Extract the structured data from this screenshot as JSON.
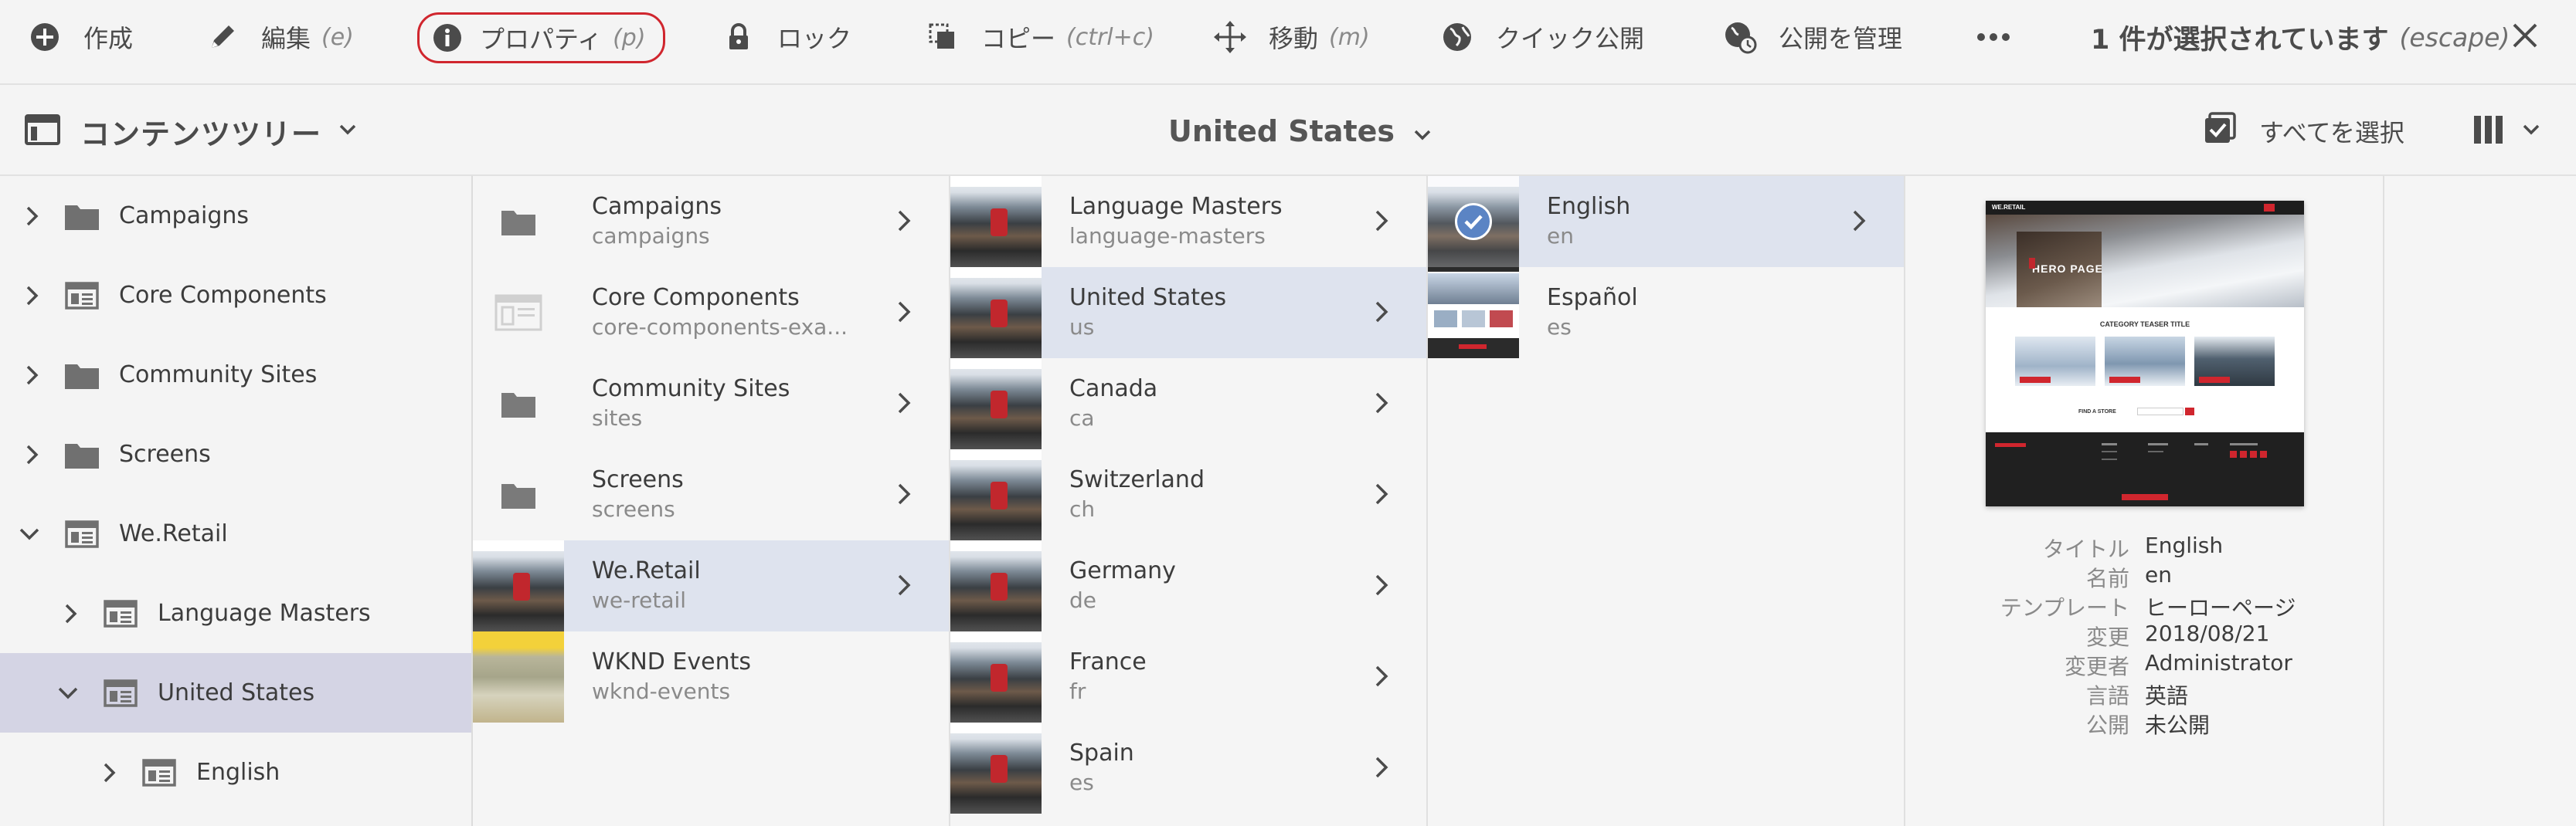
{
  "actionbar": {
    "create": {
      "label": "作成",
      "icon": "plus-circle-icon"
    },
    "edit": {
      "label": "編集",
      "shortcut": "(e)",
      "icon": "pencil-icon"
    },
    "properties": {
      "label": "プロパティ",
      "shortcut": "(p)",
      "icon": "info-icon"
    },
    "lock": {
      "label": "ロック",
      "icon": "lock-icon"
    },
    "copy": {
      "label": "コピー",
      "shortcut": "(ctrl+c)",
      "icon": "copy-icon"
    },
    "move": {
      "label": "移動",
      "shortcut": "(m)",
      "icon": "move-icon"
    },
    "quick_publish": {
      "label": "クイック公開",
      "icon": "globe-icon"
    },
    "manage_publication": {
      "label": "公開を管理",
      "icon": "globe-clock-icon"
    },
    "more": {
      "icon": "more-icon"
    },
    "selection_status": "1 件が選択されています",
    "selection_shortcut": "(escape)",
    "close": {
      "icon": "close-icon"
    }
  },
  "subbar": {
    "rail_title": "コンテンツツリー",
    "breadcrumb": "United States",
    "select_all": "すべてを選択",
    "view_icon": "column-view-icon"
  },
  "rail": {
    "items": [
      {
        "label": "Campaigns",
        "icon": "folder-icon",
        "expanded": false
      },
      {
        "label": "Core Components",
        "icon": "page-icon",
        "expanded": false
      },
      {
        "label": "Community Sites",
        "icon": "folder-icon",
        "expanded": false
      },
      {
        "label": "Screens",
        "icon": "folder-icon",
        "expanded": false
      },
      {
        "label": "We.Retail",
        "icon": "page-icon",
        "expanded": true
      },
      {
        "label": "Language Masters",
        "icon": "page-icon",
        "expanded": false
      },
      {
        "label": "United States",
        "icon": "page-icon",
        "expanded": true,
        "selected": true
      },
      {
        "label": "English",
        "icon": "page-icon",
        "expanded": false
      }
    ]
  },
  "columns": {
    "col1": [
      {
        "title": "Campaigns",
        "name": "campaigns",
        "thumb": "folder"
      },
      {
        "title": "Core Components",
        "name": "core-components-exa...",
        "thumb": "page"
      },
      {
        "title": "Community Sites",
        "name": "sites",
        "thumb": "folder"
      },
      {
        "title": "Screens",
        "name": "screens",
        "thumb": "folder"
      },
      {
        "title": "We.Retail",
        "name": "we-retail",
        "thumb": "photo",
        "active": true
      },
      {
        "title": "WKND Events",
        "name": "wknd-events",
        "thumb": "wknd"
      }
    ],
    "col2": [
      {
        "title": "Language Masters",
        "name": "language-masters",
        "thumb": "photo"
      },
      {
        "title": "United States",
        "name": "us",
        "thumb": "photo",
        "active": true
      },
      {
        "title": "Canada",
        "name": "ca",
        "thumb": "photo"
      },
      {
        "title": "Switzerland",
        "name": "ch",
        "thumb": "photo"
      },
      {
        "title": "Germany",
        "name": "de",
        "thumb": "photo"
      },
      {
        "title": "France",
        "name": "fr",
        "thumb": "photo"
      },
      {
        "title": "Spain",
        "name": "es",
        "thumb": "photo"
      }
    ],
    "col3": [
      {
        "title": "English",
        "name": "en",
        "thumb": "photo",
        "active": true,
        "checked": true,
        "has_children": true
      },
      {
        "title": "Español",
        "name": "es",
        "thumb": "es",
        "has_children": false
      }
    ]
  },
  "preview": {
    "brand": "WE.RETAIL",
    "hero": "HERO PAGE",
    "teaser": "CATEGORY TEASER TITLE",
    "find_store": "FIND A STORE",
    "meta": [
      {
        "key": "タイトル",
        "value": "English"
      },
      {
        "key": "名前",
        "value": "en"
      },
      {
        "key": "テンプレート",
        "value": "ヒーローページ"
      },
      {
        "key": "変更",
        "value": "2018/08/21"
      },
      {
        "key": "変更者",
        "value": "Administrator"
      },
      {
        "key": "言語",
        "value": "英語"
      },
      {
        "key": "公開",
        "value": "未公開"
      }
    ]
  },
  "colors": {
    "accent_red": "#d0262e",
    "selection": "#dee3ee",
    "rail_selection": "#d4d4e4",
    "check_blue": "#5b84c4"
  }
}
